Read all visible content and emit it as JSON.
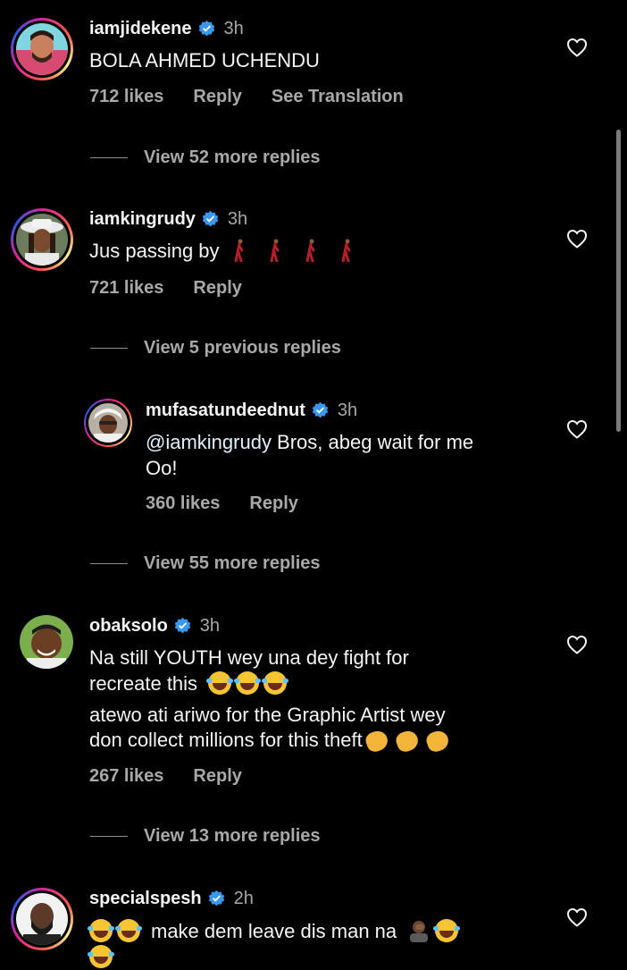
{
  "comments": [
    {
      "username": "iamjidekene",
      "time": "3h",
      "text": "BOLA AHMED UCHENDU",
      "likes": "712 likes",
      "reply": "Reply",
      "see_translation": "See Translation",
      "view_more": "View 52 more replies"
    },
    {
      "username": "iamkingrudy",
      "time": "3h",
      "text": "Jus passing by",
      "likes": "721 likes",
      "reply": "Reply",
      "view_more": "View 5 previous replies"
    },
    {
      "username": "mufasatundeednut",
      "time": "3h",
      "mention": "@iamkingrudy",
      "text_line1": " Bros, abeg wait for me",
      "text_line2": "Oo!",
      "likes": "360 likes",
      "reply": "Reply",
      "view_more": "View 55 more replies"
    },
    {
      "username": "obaksolo",
      "time": "3h",
      "text_line1": "Na still YOUTH wey una dey fight for",
      "text_line2": "recreate this",
      "text_line3": "atewo ati ariwo for the Graphic Artist wey",
      "text_line4": "don collect millions for this theft",
      "likes": "267 likes",
      "reply": "Reply",
      "view_more": "View 13 more replies"
    },
    {
      "username": "specialspesh",
      "time": "2h",
      "text": "make dem leave dis man na"
    }
  ],
  "icons": {
    "verified": "verified-badge-icon",
    "heart": "heart-outline-icon",
    "laugh": "face-with-tears-of-joy-emoji",
    "walk": "person-walking-emoji",
    "clap": "clapping-hands-emoji",
    "facepalm": "person-facepalming-emoji"
  },
  "colors": {
    "background": "#000000",
    "text": "#f5f5f5",
    "secondary": "#a8a8a8",
    "verified": "#3897f0",
    "mention": "#e0f1ff"
  }
}
